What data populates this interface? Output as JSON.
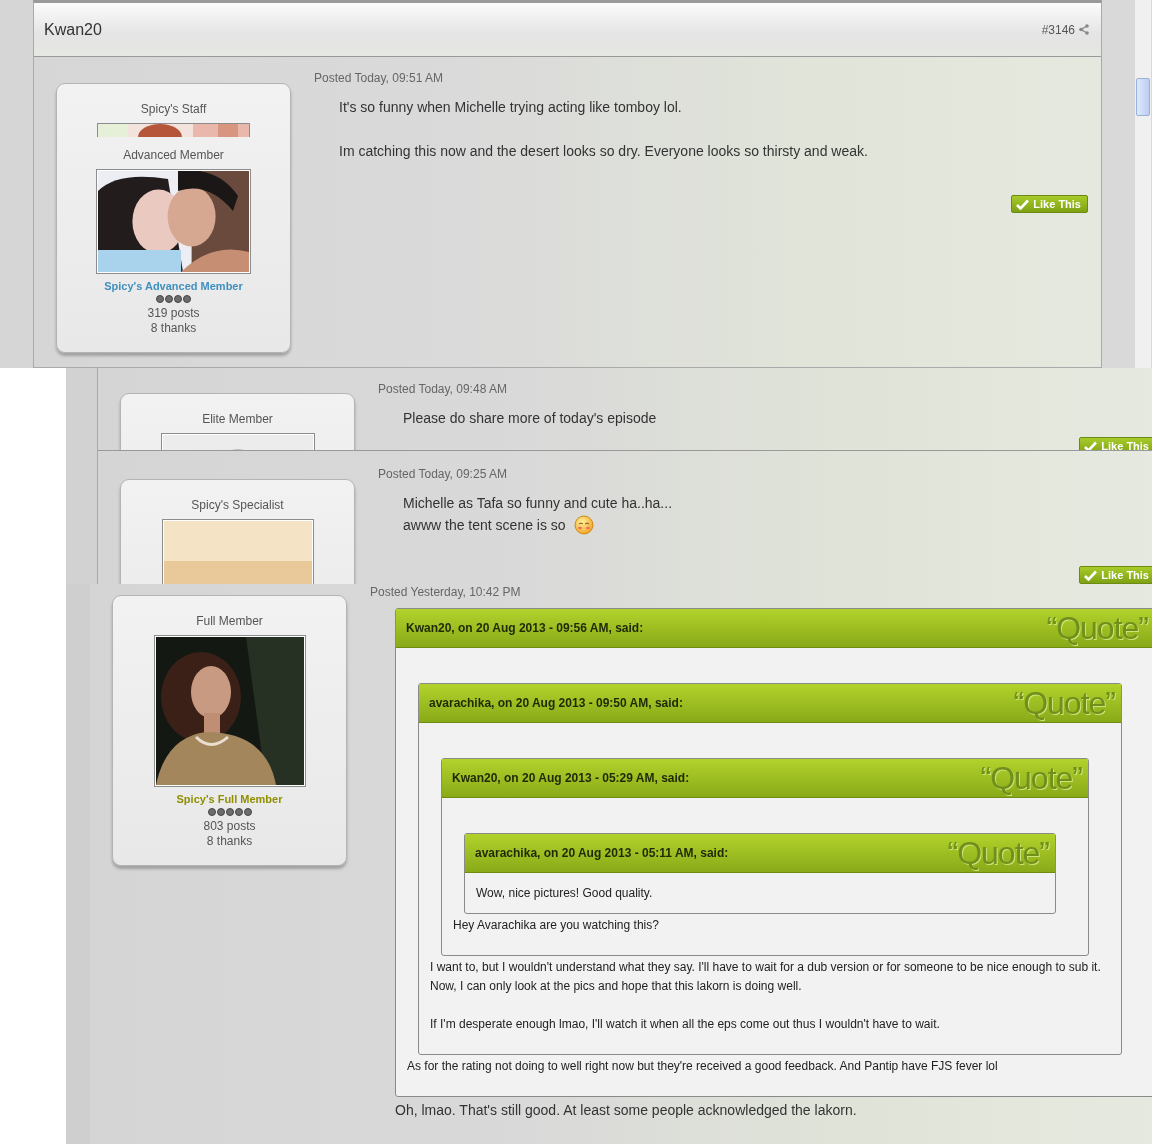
{
  "posts": [
    {
      "author": "Kwan20",
      "post_number": "#3146",
      "profile": {
        "titles": [
          "Spicy's Staff",
          "Advanced Member"
        ],
        "rank_title": "Spicy's Advanced Member",
        "color": "#3f8fbf",
        "stars": 4,
        "posts": "319 posts",
        "thanks": "8 thanks"
      },
      "posted": "Posted Today, 09:51 AM",
      "paragraphs": [
        [
          {
            "text": "It's so funny when Michelle trying acting like tomboy lol.",
            "kind": "text"
          }
        ],
        [
          {
            "text": "Im catching this now and the desert looks so dry. Everyone looks so thirsty and weak.",
            "kind": "text"
          }
        ]
      ],
      "like_button": "Like This"
    },
    {
      "profile": {
        "titles": [
          "Elite Member"
        ]
      },
      "posted": "Posted Today, 09:48 AM",
      "paragraphs": [
        [
          {
            "text": "Please do share more of today's episode",
            "kind": "text"
          }
        ]
      ],
      "like_button": "Like This"
    },
    {
      "profile": {
        "titles": [
          "Spicy's Specialist"
        ]
      },
      "posted": "Posted Today, 09:25 AM",
      "paragraphs": [
        [
          {
            "text": "Michelle as Tafa so funny and cute ha..ha...",
            "kind": "text"
          },
          {
            "text": "awww the tent scene is so",
            "kind": "smiley_after"
          }
        ]
      ],
      "like_button": "Like This"
    },
    {
      "profile": {
        "titles": [
          "Full Member"
        ],
        "rank_title": "Spicy's Full Member",
        "color": "#8f8f00",
        "stars": 5,
        "posts": "803 posts",
        "thanks": "8 thanks"
      },
      "posted": "Posted Yesterday, 10:42 PM",
      "quote": {
        "header": "Kwan20, on 20 Aug 2013 - 09:56 AM, said:",
        "label": "“Quote”",
        "quote": {
          "header": "avarachika, on 20 Aug 2013 - 09:50 AM, said:",
          "label": "“Quote”",
          "quote": {
            "header": "Kwan20, on 20 Aug 2013 - 05:29 AM, said:",
            "label": "“Quote”",
            "quote": {
              "header": "avarachika, on 20 Aug 2013 - 05:11 AM, said:",
              "label": "“Quote”",
              "paragraphs": [
                [
                  "Wow, nice pictures! Good quality."
                ]
              ]
            },
            "paragraphs": [
              [
                "Hey Avarachika are you watching this?"
              ]
            ]
          },
          "paragraphs": [
            [
              "I want to, but I wouldn't understand what they say. I'll have to wait for a dub version or for someone to be nice enough to sub it.",
              "Now, I can only look at the pics and hope that this lakorn is doing well."
            ],
            [
              "If I'm desperate enough lmao, I'll watch it when all the eps come out thus I wouldn't have to wait."
            ]
          ]
        },
        "paragraphs": [
          [
            "As for the rating not doing to well right now but they're received a good feedback. And Pantip have FJS fever lol"
          ]
        ]
      },
      "paragraphs": [
        [
          {
            "text": "Oh, lmao. That's still good. At least some people acknowledged the lakorn.",
            "kind": "text"
          }
        ]
      ]
    }
  ]
}
